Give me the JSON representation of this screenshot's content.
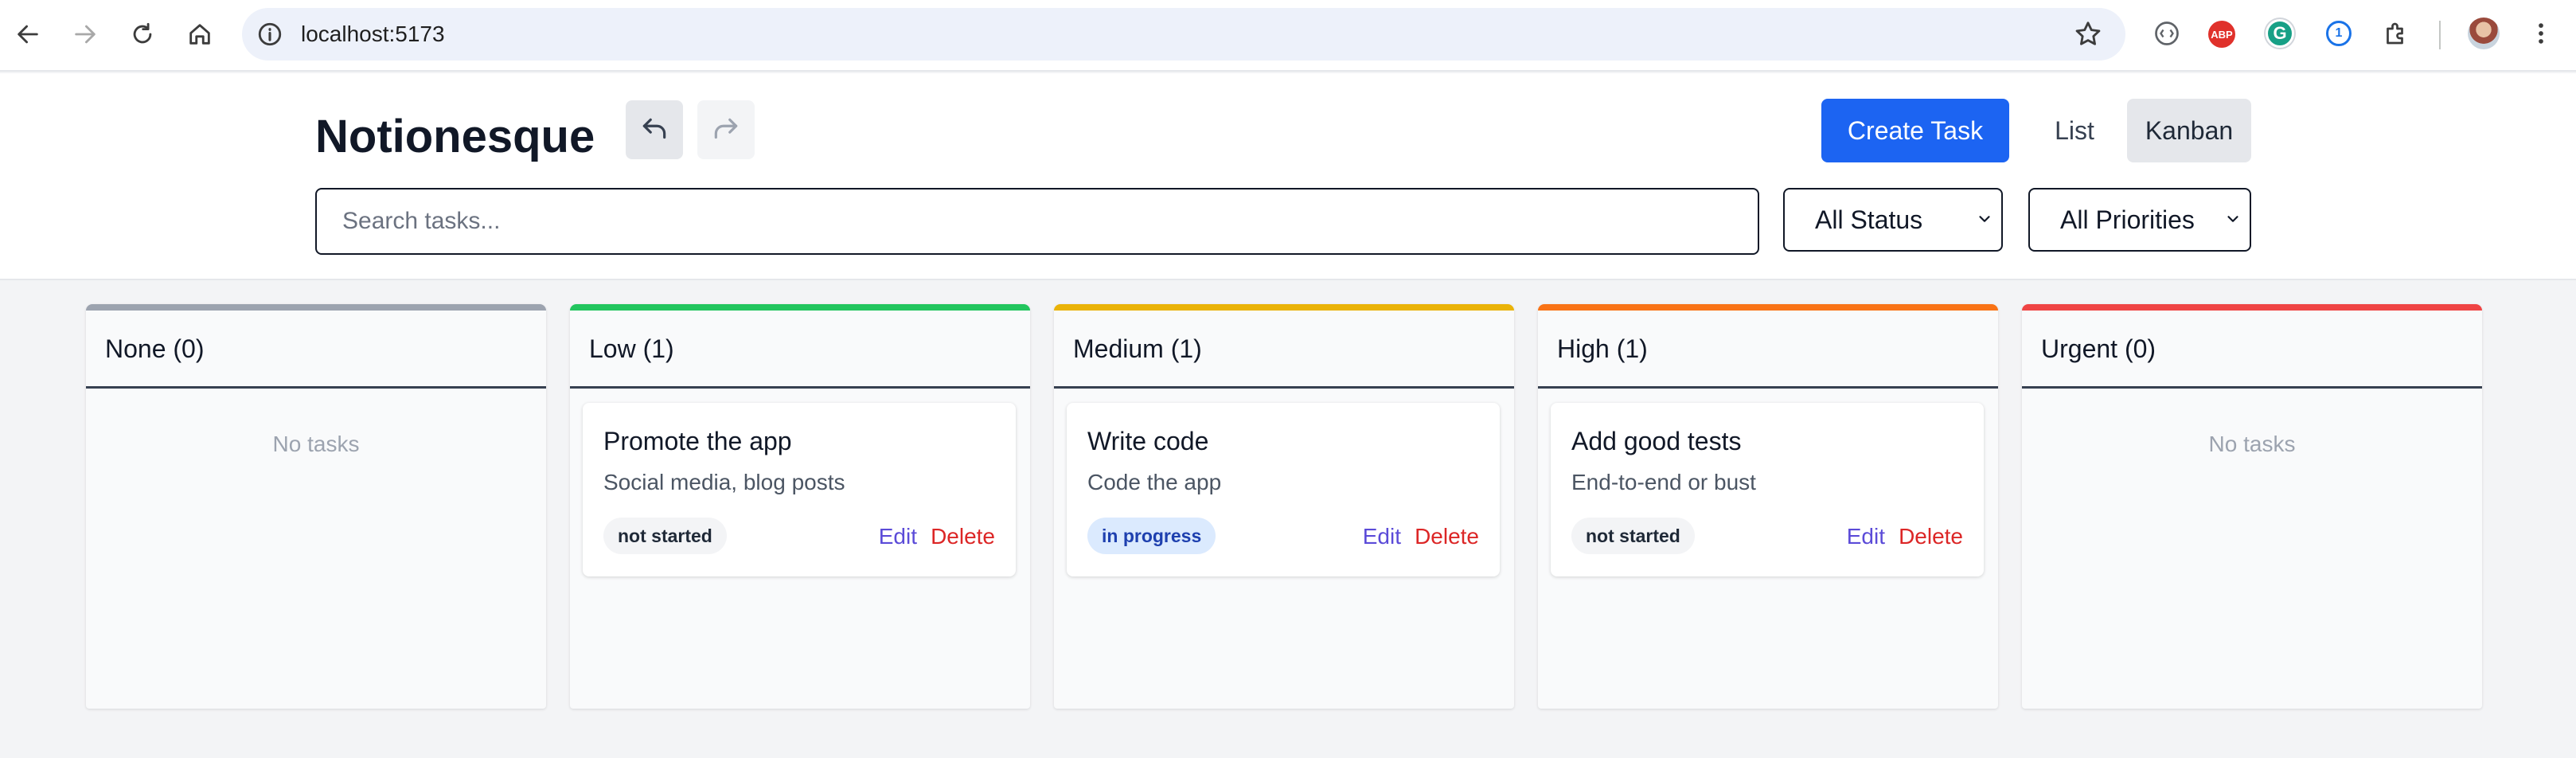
{
  "browser": {
    "url": "localhost:5173",
    "icons": [
      "back-icon",
      "forward-icon",
      "reload-icon",
      "home-icon",
      "site-info-icon",
      "bookmark-star-icon",
      "extension-icon",
      "adblock-icon",
      "grammarly-icon",
      "password-manager-icon",
      "puzzle-icon",
      "profile-avatar",
      "kebab-menu-icon"
    ],
    "abp_label": "ABP",
    "grammarly_label": "G",
    "password_label": "1"
  },
  "header": {
    "title": "Notionesque",
    "create_label": "Create Task",
    "list_label": "List",
    "kanban_label": "Kanban"
  },
  "search": {
    "placeholder": "Search tasks..."
  },
  "filters": {
    "status": {
      "selected": "All Status"
    },
    "priority": {
      "selected": "All Priorities"
    }
  },
  "board": {
    "empty_label": "No tasks",
    "columns": [
      {
        "title": "None (0)",
        "color": "#9ca3af",
        "cards": []
      },
      {
        "title": "Low (1)",
        "color": "#22c55e",
        "cards": [
          {
            "title": "Promote the app",
            "description": "Social media, blog posts",
            "status": "not started",
            "edit": "Edit",
            "delete": "Delete"
          }
        ]
      },
      {
        "title": "Medium (1)",
        "color": "#eab308",
        "cards": [
          {
            "title": "Write code",
            "description": "Code the app",
            "status": "in progress",
            "edit": "Edit",
            "delete": "Delete"
          }
        ]
      },
      {
        "title": "High (1)",
        "color": "#f97316",
        "cards": [
          {
            "title": "Add good tests",
            "description": "End-to-end or bust",
            "status": "not started",
            "edit": "Edit",
            "delete": "Delete"
          }
        ]
      },
      {
        "title": "Urgent (0)",
        "color": "#ef4444",
        "cards": []
      }
    ]
  },
  "colors": {
    "primary": "#1c64f2",
    "edit_link": "#5b4bd8",
    "delete_link": "#dc2626",
    "status_in_progress_bg": "#dbeafe",
    "status_not_started_bg": "#f3f4f6"
  }
}
